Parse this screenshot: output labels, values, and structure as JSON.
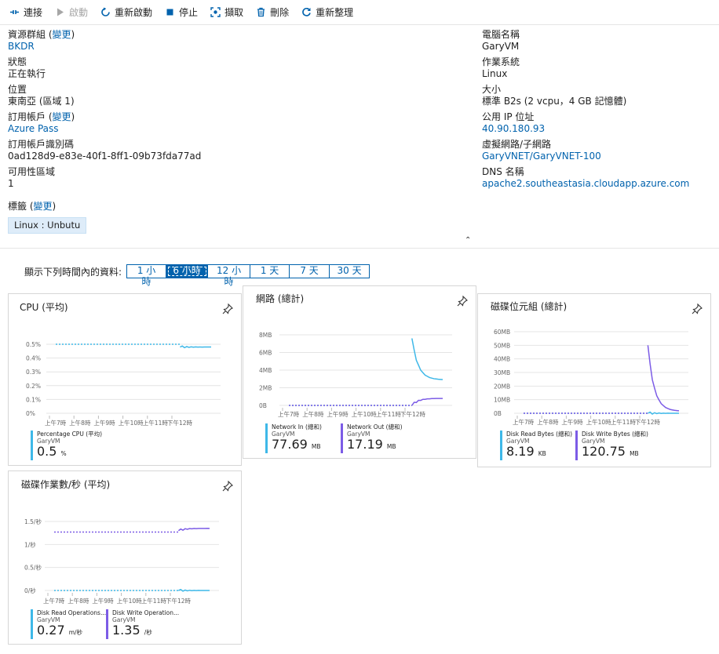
{
  "toolbar": {
    "connect": "連接",
    "start": "啟動",
    "restart": "重新啟動",
    "stop": "停止",
    "capture": "擷取",
    "delete": "刪除",
    "refresh": "重新整理"
  },
  "essentials": {
    "left": {
      "resource_group_label": "資源群組 (",
      "change_link": "變更",
      "close_paren": ")",
      "resource_group": "BKDR",
      "status_label": "狀態",
      "status": "正在執行",
      "location_label": "位置",
      "location": "東南亞 (區域 1)",
      "subscription_label": "訂用帳戶 (",
      "subscription": "Azure Pass",
      "subscription_id_label": "訂用帳戶識別碼",
      "subscription_id": "0ad128d9-e83e-40f1-8ff1-09b73fda77ad",
      "zone_label": "可用性區域",
      "zone": "1",
      "tags_label": "標籤 (",
      "tag": "Linux : Unbutu"
    },
    "right": {
      "computer_name_label": "電腦名稱",
      "computer_name": "GaryVM",
      "os_label": "作業系統",
      "os": "Linux",
      "size_label": "大小",
      "size": "標準 B2s (2 vcpu，4 GB 記憶體)",
      "public_ip_label": "公用 IP 位址",
      "public_ip": "40.90.180.93",
      "vnet_label": "虛擬網路/子網路",
      "vnet": "GaryVNET/GaryVNET-100",
      "dns_label": "DNS 名稱",
      "dns": "apache2.southeastasia.cloudapp.azure.com"
    }
  },
  "time_range": {
    "label": "顯示下列時間內的資料:",
    "options": [
      "1 小時",
      "6 小時",
      "12 小時",
      "1 天",
      "7 天",
      "30 天"
    ],
    "selected": "6 小時"
  },
  "x_ticks": [
    "上午7時",
    "上午8時",
    "上午9時",
    "上午10時",
    "上午11時",
    "下午12時"
  ],
  "tiles": {
    "cpu": {
      "title": "CPU (平均)",
      "y_ticks": [
        "0.5%",
        "0.4%",
        "0.3%",
        "0.2%",
        "0.1%",
        "0%"
      ],
      "metrics": [
        {
          "name": "Percentage CPU (平均)",
          "resource": "GaryVM",
          "value": "0.5",
          "unit": "%",
          "color": "#3eb8e8"
        }
      ]
    },
    "network": {
      "title": "網路 (總計)",
      "y_ticks": [
        "8MB",
        "6MB",
        "4MB",
        "2MB",
        "0B"
      ],
      "metrics": [
        {
          "name": "Network In (總和)",
          "resource": "GaryVM",
          "value": "77.69",
          "unit": "MB",
          "color": "#3eb8e8"
        },
        {
          "name": "Network Out (總和)",
          "resource": "GaryVM",
          "value": "17.19",
          "unit": "MB",
          "color": "#7c5ce6"
        }
      ]
    },
    "disk_bytes": {
      "title": "磁碟位元組 (總計)",
      "y_ticks": [
        "60MB",
        "50MB",
        "40MB",
        "30MB",
        "20MB",
        "10MB",
        "0B"
      ],
      "metrics": [
        {
          "name": "Disk Read Bytes (總和)",
          "resource": "GaryVM",
          "value": "8.19",
          "unit": "KB",
          "color": "#3eb8e8"
        },
        {
          "name": "Disk Write Bytes (總和)",
          "resource": "GaryVM",
          "value": "120.75",
          "unit": "MB",
          "color": "#7c5ce6"
        }
      ]
    },
    "disk_ops": {
      "title": "磁碟作業數/秒 (平均)",
      "y_ticks": [
        "1.5/秒",
        "1/秒",
        "0.5/秒",
        "0/秒"
      ],
      "metrics": [
        {
          "name": "Disk Read Operations...",
          "resource": "GaryVM",
          "value": "0.27",
          "unit": "m/秒",
          "color": "#3eb8e8"
        },
        {
          "name": "Disk Write Operation...",
          "resource": "GaryVM",
          "value": "1.35",
          "unit": "/秒",
          "color": "#7c5ce6"
        }
      ]
    }
  },
  "chart_data": [
    {
      "type": "line",
      "title": "CPU (平均)",
      "categories": [
        "上午7時",
        "上午8時",
        "上午9時",
        "上午10時",
        "上午11時",
        "下午12時"
      ],
      "ylim": [
        0,
        0.5
      ],
      "series": [
        {
          "name": "Percentage CPU (平均)",
          "values": [
            0.5,
            0.5,
            0.5,
            0.5,
            0.48,
            0.48
          ]
        }
      ]
    },
    {
      "type": "line",
      "title": "網路 (總計)",
      "categories": [
        "上午7時",
        "上午8時",
        "上午9時",
        "上午10時",
        "上午11時",
        "下午12時"
      ],
      "ylim": [
        0,
        8
      ],
      "series": [
        {
          "name": "Network In (總和)",
          "values": [
            0,
            0,
            0,
            0,
            7.6,
            2.9
          ]
        },
        {
          "name": "Network Out (總和)",
          "values": [
            0,
            0,
            0,
            0,
            0,
            0.8
          ]
        }
      ]
    },
    {
      "type": "line",
      "title": "磁碟位元組 (總計)",
      "categories": [
        "上午7時",
        "上午8時",
        "上午9時",
        "上午10時",
        "上午11時",
        "下午12時"
      ],
      "ylim": [
        0,
        60
      ],
      "series": [
        {
          "name": "Disk Read Bytes (總和)",
          "values": [
            0,
            0,
            0,
            0,
            0,
            0
          ]
        },
        {
          "name": "Disk Write Bytes (總和)",
          "values": [
            0,
            0,
            0,
            0,
            50,
            1.5
          ]
        }
      ]
    },
    {
      "type": "line",
      "title": "磁碟作業數/秒 (平均)",
      "categories": [
        "上午7時",
        "上午8時",
        "上午9時",
        "上午10時",
        "上午11時",
        "下午12時"
      ],
      "ylim": [
        0,
        1.5
      ],
      "series": [
        {
          "name": "Disk Read Operations...",
          "values": [
            0,
            0,
            0,
            0,
            0,
            0
          ]
        },
        {
          "name": "Disk Write Operation...",
          "values": [
            1.27,
            1.27,
            1.27,
            1.27,
            1.3,
            1.35
          ]
        }
      ]
    }
  ]
}
